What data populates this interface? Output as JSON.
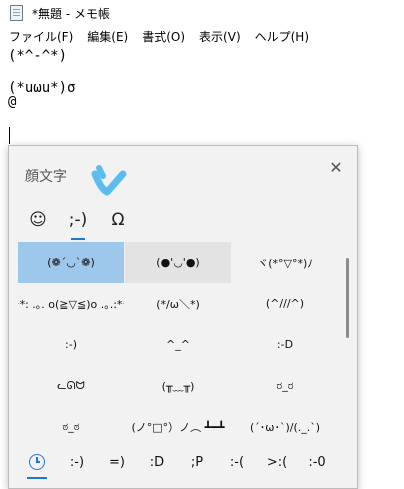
{
  "window": {
    "title": "*無題 - メモ帳",
    "menu": [
      "ファイル(F)",
      "編集(E)",
      "書式(O)",
      "表示(V)",
      "ヘルプ(H)"
    ]
  },
  "editor": {
    "lines": [
      "(*^-^*)",
      "",
      "(*uωu*)σ",
      "@",
      "",
      ""
    ]
  },
  "panel": {
    "title": "顔文字",
    "close_label": "✕",
    "top_tabs": [
      {
        "label": "☺",
        "icon": "smiley-icon",
        "active": false
      },
      {
        "label": ";-)",
        "icon": "kaomoji-icon",
        "active": true
      },
      {
        "label": "Ω",
        "icon": "omega-symbol-icon",
        "active": false
      }
    ],
    "kaomoji": [
      "(❁´◡`❁)",
      "(●'◡'●)",
      "ヾ(*°▽°*)ﾉ",
      "☆*: .｡. o(≧▽≦)o .｡.:*☆",
      "(*/ω＼*)",
      "(^///^)",
      ":-)",
      "^_^",
      ":-D",
      "ᓚᘏᗢ",
      "(╥﹏╥)",
      "ರ_ರ",
      "ಠ_ಠ",
      "(ノ°□°）ノ︵ ┻━┻",
      "(´･ω･`)/(._.`)"
    ],
    "selected_index": 0,
    "hover_index": 1,
    "bottom_tabs": [
      {
        "label": "",
        "icon": "clock-icon",
        "active": true
      },
      {
        "label": ":-)"
      },
      {
        "label": "=)"
      },
      {
        "label": ":D"
      },
      {
        "label": ";P"
      },
      {
        "label": ":-("
      },
      {
        "label": ">:("
      },
      {
        "label": ":-0"
      }
    ],
    "accent_color": "#1e78d4",
    "annotation_color": "#5bbcf0"
  }
}
